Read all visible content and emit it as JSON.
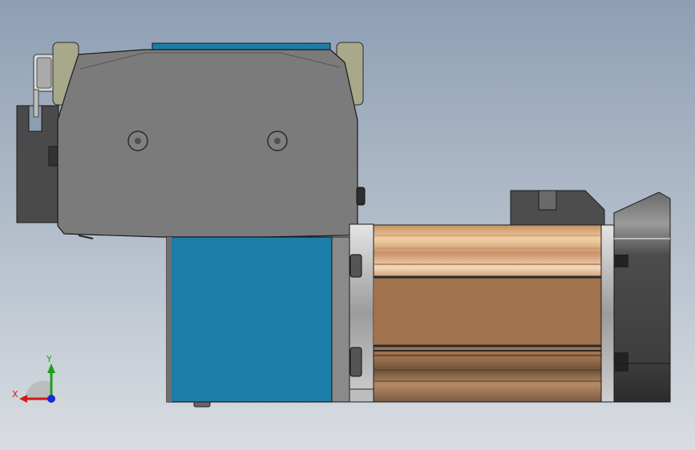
{
  "viewport": {
    "background_top": "#8e9fb4",
    "background_bottom": "#d9dde2"
  },
  "triad": {
    "x_label": "X",
    "y_label": "Y",
    "x_color": "#d11a1a",
    "y_color": "#1aa01a",
    "z_color": "#1a2ad1"
  },
  "colors": {
    "housing_gray": "#7b7b7b",
    "bracket_dark": "#4a4a4a",
    "knob_beige": "#a8a88a",
    "blue_plate": "#1c7ea8",
    "motor_copper": "#a0724e",
    "motor_highlight": "#f0c8a0",
    "end_cap_dark": "#3a3a3a"
  }
}
